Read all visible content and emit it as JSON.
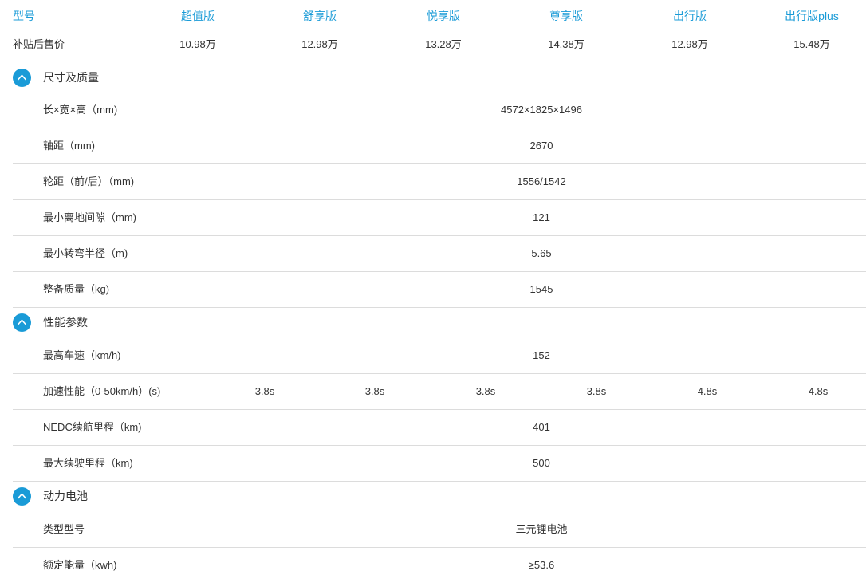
{
  "header": {
    "model_label": "型号",
    "price_label": "补贴后售价",
    "models": [
      "超值版",
      "舒享版",
      "悦享版",
      "尊享版",
      "出行版",
      "出行版plus"
    ],
    "prices": [
      "10.98万",
      "12.98万",
      "13.28万",
      "14.38万",
      "12.98万",
      "15.48万"
    ]
  },
  "colors": {
    "accent": "#1a9bd7",
    "divider": "#dcdcdc",
    "text": "#333333"
  },
  "sections": [
    {
      "title": "尺寸及质量",
      "toggle_icon": "chevron-up-icon",
      "rows": [
        {
          "label": "长×宽×高（mm)",
          "value": "4572×1825×1496"
        },
        {
          "label": "轴距（mm)",
          "value": "2670"
        },
        {
          "label": "轮距（前/后）（mm)",
          "value": "1556/1542"
        },
        {
          "label": "最小离地间隙（mm)",
          "value": "121"
        },
        {
          "label": "最小转弯半径（m)",
          "value": "5.65"
        },
        {
          "label": "整备质量（kg)",
          "value": "1545"
        }
      ]
    },
    {
      "title": "性能参数",
      "toggle_icon": "chevron-up-icon",
      "rows": [
        {
          "label": "最高车速（km/h)",
          "value": "152"
        },
        {
          "label": "加速性能（0-50km/h）(s)",
          "values": [
            "3.8s",
            "3.8s",
            "3.8s",
            "3.8s",
            "4.8s",
            "4.8s"
          ]
        },
        {
          "label": "NEDC续航里程（km)",
          "value": "401"
        },
        {
          "label": "最大续驶里程（km)",
          "value": "500"
        }
      ]
    },
    {
      "title": "动力电池",
      "toggle_icon": "chevron-up-icon",
      "rows": [
        {
          "label": "类型型号",
          "value": "三元锂电池"
        },
        {
          "label": "额定能量（kwh)",
          "value": "≥53.6"
        }
      ]
    }
  ]
}
